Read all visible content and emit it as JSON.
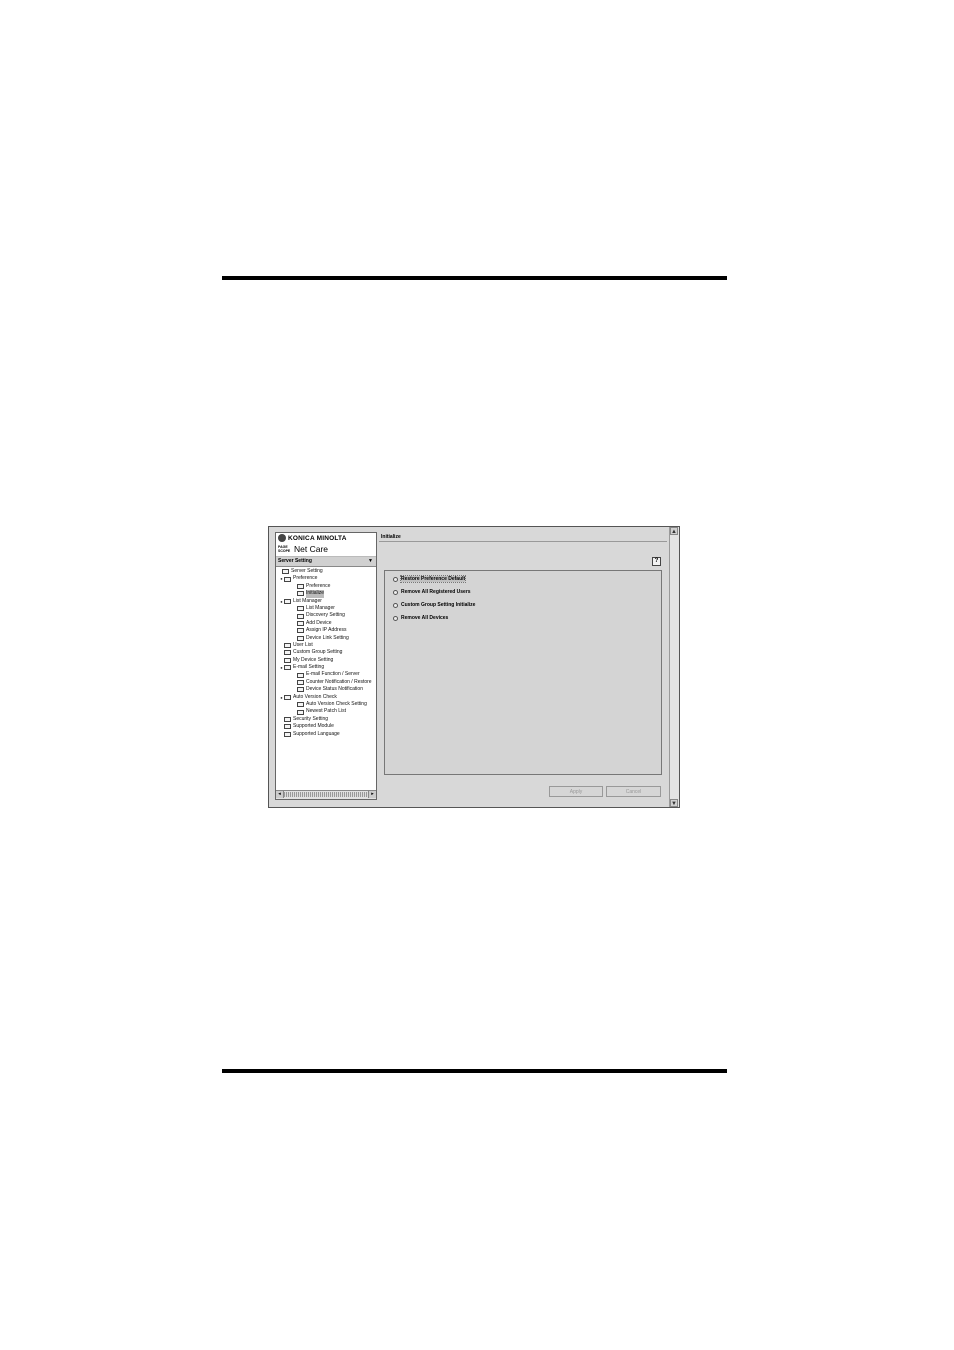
{
  "brand": {
    "company": "KONICA MINOLTA",
    "pagescope": "PAGE SCOPE",
    "product": "Net Care"
  },
  "selector": {
    "value": "Server Setting"
  },
  "tree": [
    {
      "label": "Server Setting",
      "level": 0,
      "icon": "folder-icon"
    },
    {
      "label": "Preference",
      "level": 1,
      "icon": "folder-icon",
      "toggle": "expanded"
    },
    {
      "label": "Preference",
      "level": 2,
      "icon": "page-icon"
    },
    {
      "label": "Initialize",
      "level": 2,
      "icon": "page-icon",
      "selected": true
    },
    {
      "label": "List Manager",
      "level": 1,
      "icon": "folder-icon",
      "toggle": "expanded"
    },
    {
      "label": "List Manager",
      "level": 2,
      "icon": "page-icon"
    },
    {
      "label": "Discovery Setting",
      "level": 2,
      "icon": "page-icon"
    },
    {
      "label": "Add Device",
      "level": 2,
      "icon": "device-icon"
    },
    {
      "label": "Assign IP Address",
      "level": 2,
      "icon": "page-icon"
    },
    {
      "label": "Device Link Setting",
      "level": 2,
      "icon": "link-icon"
    },
    {
      "label": "User List",
      "level": 1,
      "icon": "user-icon"
    },
    {
      "label": "Custom Group Setting",
      "level": 1,
      "icon": "group-icon"
    },
    {
      "label": "My Device Setting",
      "level": 1,
      "icon": "device-icon"
    },
    {
      "label": "E-mail Setting",
      "level": 1,
      "icon": "folder-icon",
      "toggle": "expanded"
    },
    {
      "label": "E-mail Function / Server",
      "level": 2,
      "icon": "mail-icon"
    },
    {
      "label": "Counter Notification / Restore",
      "level": 2,
      "icon": "mail-icon"
    },
    {
      "label": "Device Status Notification",
      "level": 2,
      "icon": "mail-icon"
    },
    {
      "label": "Auto Version Check",
      "level": 1,
      "icon": "folder-icon",
      "toggle": "expanded"
    },
    {
      "label": "Auto Version Check Setting",
      "level": 2,
      "icon": "page-icon"
    },
    {
      "label": "Newest Patch List",
      "level": 2,
      "icon": "page-icon"
    },
    {
      "label": "Security Setting",
      "level": 1,
      "icon": "key-icon"
    },
    {
      "label": "Supported Module",
      "level": 1,
      "icon": "module-icon"
    },
    {
      "label": "Supported Language",
      "level": 1,
      "icon": "language-icon"
    }
  ],
  "panel": {
    "title": "Initialize",
    "help_icon": "help-icon",
    "options": [
      {
        "label": "Restore Preference Default",
        "selected": true
      },
      {
        "label": "Remove All Registered Users",
        "selected": false
      },
      {
        "label": "Custom Group Setting Initialize",
        "selected": false
      },
      {
        "label": "Remove All Devices",
        "selected": false
      }
    ],
    "apply_label": "Apply",
    "cancel_label": "Cancel"
  }
}
